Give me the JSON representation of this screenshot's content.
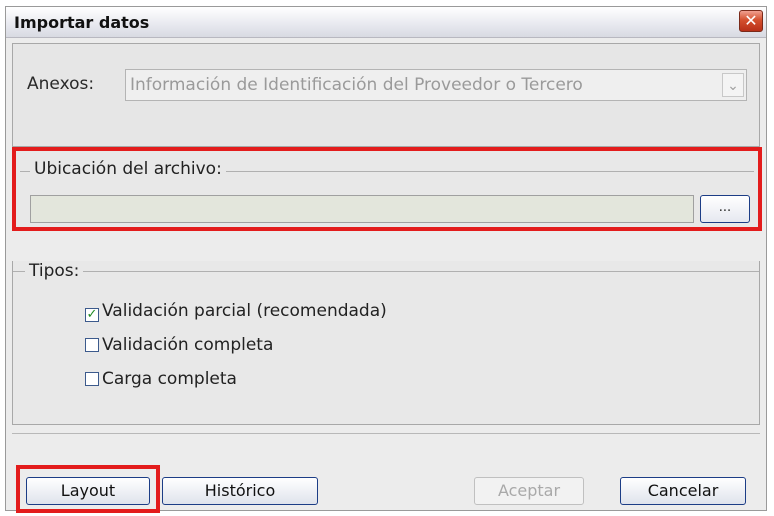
{
  "window": {
    "title": "Importar datos",
    "close_symbol": "✕"
  },
  "annexes": {
    "label": "Anexos:",
    "value": "Información de Identificación del Proveedor o Tercero",
    "arrow": "⌄"
  },
  "file": {
    "legend": "Ubicación del archivo:",
    "path_value": "",
    "browse_label": "..."
  },
  "types": {
    "legend": "Tipos:",
    "options": [
      {
        "label": "Validación parcial (recomendada)",
        "checked": true
      },
      {
        "label": "Validación completa",
        "checked": false
      },
      {
        "label": "Carga completa",
        "checked": false
      }
    ],
    "check_mark": "✓"
  },
  "buttons": {
    "layout": "Layout",
    "history": "Histórico",
    "accept": "Aceptar",
    "cancel": "Cancelar"
  },
  "colors": {
    "highlight": "#e31c1c",
    "button_border": "#1c3d86"
  }
}
